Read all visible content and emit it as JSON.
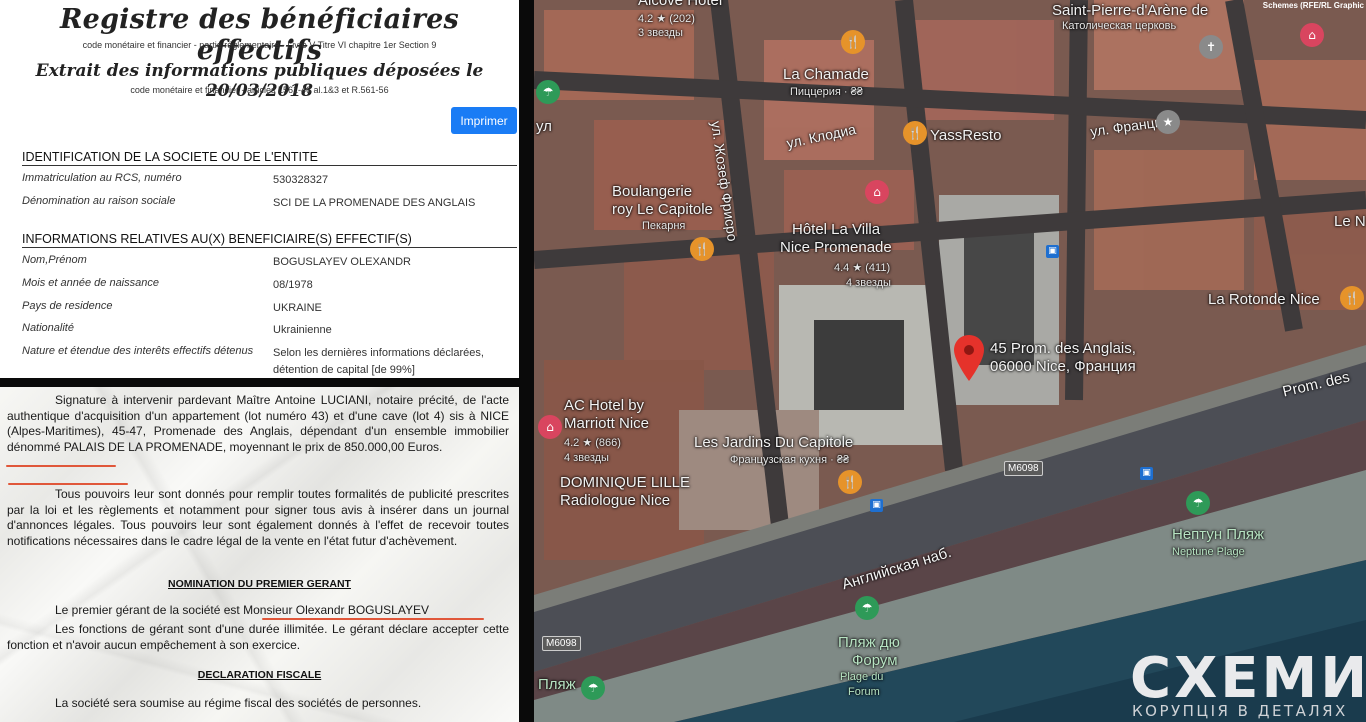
{
  "registry": {
    "title": "Registre des bénéficiaires effectifs",
    "subtitle": "code monétaire et financier - partie réglementaire - Livre V Titre VI chapitre 1er Section 9",
    "extract_title": "Extrait des informations publiques déposées le 20/03/2018",
    "extract_subtitle": "code monétaire et financier - articles L561-46 al.1&3 et R.561-56",
    "print_label": "Imprimer",
    "identification": {
      "heading": "IDENTIFICATION DE LA SOCIETE OU DE L'ENTITE",
      "rows": [
        {
          "label": "Immatriculation au RCS, numéro",
          "value": "530328327"
        },
        {
          "label": "Dénomination au raison sociale",
          "value": "SCI DE LA PROMENADE DES ANGLAIS"
        }
      ]
    },
    "beneficiaries": {
      "heading": "INFORMATIONS RELATIVES AU(X) BENEFICIAIRE(S) EFFECTIF(S)",
      "rows": [
        {
          "label": "Nom,Prénom",
          "value": "BOGUSLAYEV OLEXANDR"
        },
        {
          "label": "Mois et année de naissance",
          "value": "08/1978"
        },
        {
          "label": "Pays de residence",
          "value": "UKRAINE"
        },
        {
          "label": "Nationalité",
          "value": "Ukrainienne"
        },
        {
          "label": "Nature et étendue des interêts effectifs détenus",
          "value": "Selon les dernières informations déclarées, détention de capital [de 99%]"
        }
      ]
    }
  },
  "deed": {
    "para1": "Signature à intervenir pardevant Maître Antoine LUCIANI, notaire précité, de l'acte authentique d'acquisition d'un appartement (lot numéro 43) et d'une cave (lot 4) sis à NICE (Alpes-Maritimes), 45-47, Promenade des Anglais, dépendant d'un ensemble immobilier dénommé PALAIS DE LA PROMENADE, moyennant le prix de 850.000,00 Euros.",
    "para2": "Tous pouvoirs leur sont donnés pour remplir toutes formalités de publicité prescrites par la loi et les règlements et notamment pour signer tous avis à insérer dans un journal d'annonces légales. Tous pouvoirs leur sont également donnés à l'effet de recevoir toutes notifications nécessaires dans le cadre légal de la vente en l'état futur d'achèvement.",
    "heading1": "NOMINATION DU PREMIER GERANT",
    "para3a": "Le premier gérant de la société est  Monsieur Olexandr BOGUSLAYEV",
    "para3b": "Les fonctions de gérant sont d'une durée illimitée. Le gérant déclare accepter cette fonction et n'avoir aucun empêchement à son exercice.",
    "heading2": "DECLARATION FISCALE",
    "para4": "La société sera soumise au régime fiscal des sociétés de personnes."
  },
  "map": {
    "credit": "Schemes (RFE/RL Graphic",
    "labels": {
      "alcove": "Alcove Hotel",
      "alcove_rating": "4.2 ★ (202)",
      "alcove_stars": "3 звезды",
      "st_pierre_1": "Saint-Pierre-d'Arène de",
      "st_pierre_2": "Католическая церковь",
      "chamade": "La Chamade",
      "chamade_sub": "Пиццерия · ₴₴",
      "yassresto": "YassResto",
      "ul_jozef": "ул. Жозеф Фрисро",
      "ul_klodia": "ул. Клодиа",
      "ul_francia": "ул. Франция",
      "boulangerie_1": "Boulangerie",
      "boulangerie_2": "roy Le Capitole",
      "boulangerie_sub": "Пекарня",
      "villa_1": "Hôtel La Villa",
      "villa_2": "Nice Promenade",
      "villa_rating": "4.4 ★ (411)",
      "villa_stars": "4 звезды",
      "rotonde": "La Rotonde Nice",
      "address_1": "45 Prom. des Anglais,",
      "address_2": "06000 Nice, Франция",
      "prom": "Prom. des",
      "ac_1": "AC Hotel by",
      "ac_2": "Marriott Nice",
      "ac_rating": "4.2 ★ (866)",
      "ac_stars": "4 звезды",
      "jardins": "Les Jardins Du Capitole",
      "jardins_sub": "Французская кухня · ₴₴",
      "dominique_1": "DOMINIQUE LILLE",
      "dominique_2": "Radiologue Nice",
      "m6098_a": "M6098",
      "m6098_b": "M6098",
      "angl": "Английская наб.",
      "neptune_1": "Нептун Пляж",
      "neptune_2": "Neptune Plage",
      "forum_1": "Пляж дю",
      "forum_2": "Форум",
      "forum_3": "Plage du",
      "forum_4": "Forum",
      "plyazh": "Пляж",
      "ul_left": "ул",
      "le_n": "Le N"
    }
  },
  "logo": {
    "name": "СХЕМИ",
    "tagline": "КОРУПЦІЯ В ДЕТАЛЯХ"
  }
}
